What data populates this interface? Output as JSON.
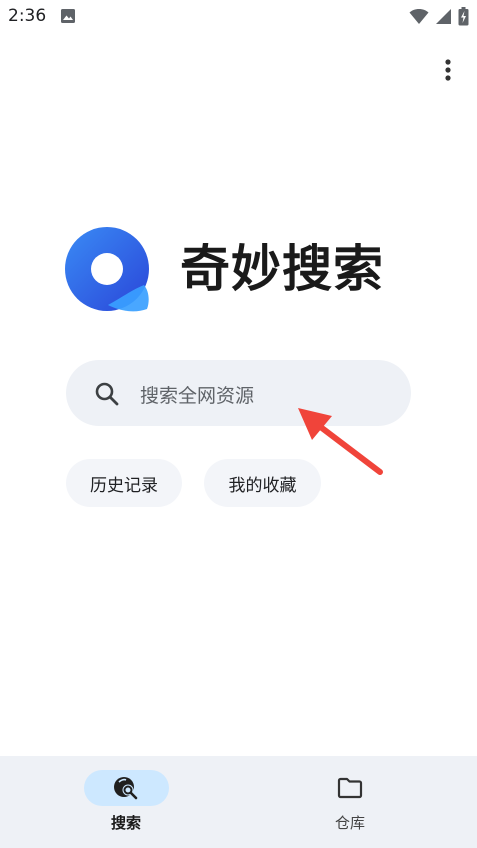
{
  "status_bar": {
    "time": "2:36",
    "icons": [
      "photo-icon",
      "wifi-icon",
      "signal-icon",
      "battery-charging-icon"
    ]
  },
  "menu": {
    "icon": "more-vert-icon"
  },
  "app": {
    "title": "奇妙搜索",
    "logo": "qimiao-logo",
    "colors": {
      "logo_blue_dark": "#2b4fe0",
      "logo_blue_light": "#3aa0ff"
    }
  },
  "search": {
    "placeholder": "搜索全网资源",
    "icon": "search-icon"
  },
  "chips": [
    {
      "label": "历史记录"
    },
    {
      "label": "我的收藏"
    }
  ],
  "bottom_nav": {
    "items": [
      {
        "label": "搜索",
        "icon": "search-nav-icon",
        "active": true
      },
      {
        "label": "仓库",
        "icon": "folder-icon",
        "active": false
      }
    ],
    "active_pill_color": "#cde8ff"
  },
  "annotation": {
    "color": "#f0443a",
    "icon": "red-arrow-icon"
  }
}
